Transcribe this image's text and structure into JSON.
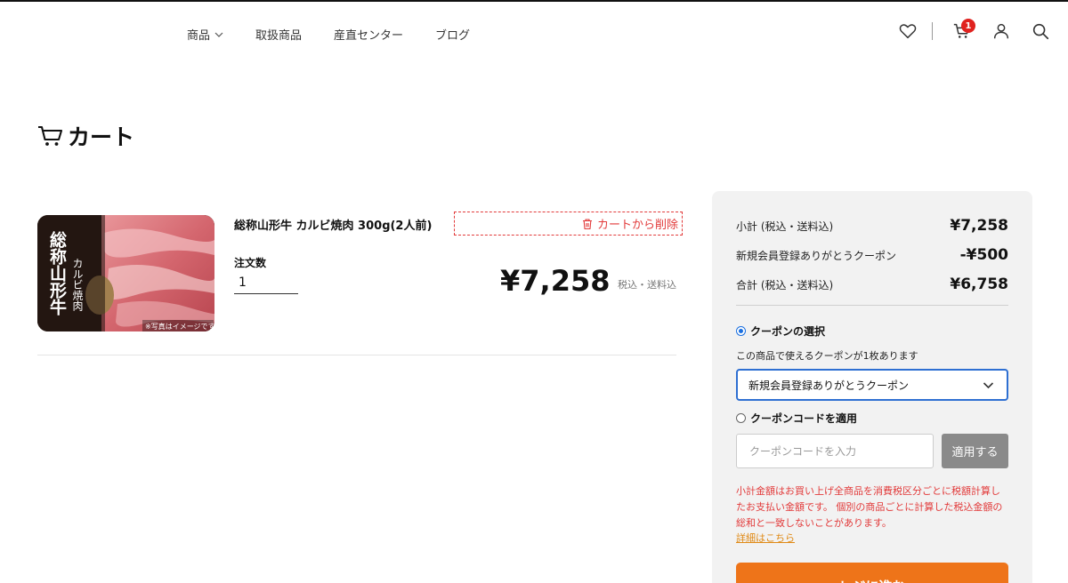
{
  "header": {
    "nav": [
      {
        "label": "商品"
      },
      {
        "label": "取扱商品"
      },
      {
        "label": "産直センター"
      },
      {
        "label": "ブログ"
      }
    ],
    "cart_count": "1"
  },
  "page": {
    "title": "カート"
  },
  "cart_item": {
    "name": "総称山形牛 カルビ焼肉 300g(2人前)",
    "remove_label": "カートから削除",
    "quantity_label": "注文数",
    "quantity": "1",
    "price": "¥7,258",
    "price_note": "税込・送料込",
    "image_text": {
      "line1": "総称山形牛",
      "line2": "カルビ焼肉",
      "caption": "※写真はイメージです"
    }
  },
  "summary": {
    "subtotal_label": "小計 (税込・送料込)",
    "subtotal_value": "¥7,258",
    "coupon_label": "新規会員登録ありがとうクーポン",
    "coupon_value": "-¥500",
    "total_label": "合計 (税込・送料込)",
    "total_value": "¥6,758",
    "coupon_select_heading": "クーポンの選択",
    "coupon_available_note": "この商品で使えるクーポンが1枚あります",
    "coupon_selected": "新規会員登録ありがとうクーポン",
    "coupon_code_heading": "クーポンコードを適用",
    "coupon_code_placeholder": "クーポンコードを入力",
    "apply_label": "適用する",
    "notice": "小計金額はお買い上げ全商品を消費税区分ごとに税額計算したお支払い金額です。 個別の商品ごとに計算した税込金額の総和と一致しないことがあります。",
    "detail_link": "詳細はこちら",
    "checkout_label": "レジに進む"
  },
  "colors": {
    "accent_orange": "#ee7419",
    "alert_red": "#e23a3a",
    "badge_red": "#e0221f",
    "select_blue": "#2e6fd2",
    "panel_bg": "#f2f2f2"
  },
  "icons": [
    "chevron-down-icon",
    "heart-icon",
    "cart-icon",
    "user-icon",
    "search-icon",
    "trash-icon"
  ]
}
